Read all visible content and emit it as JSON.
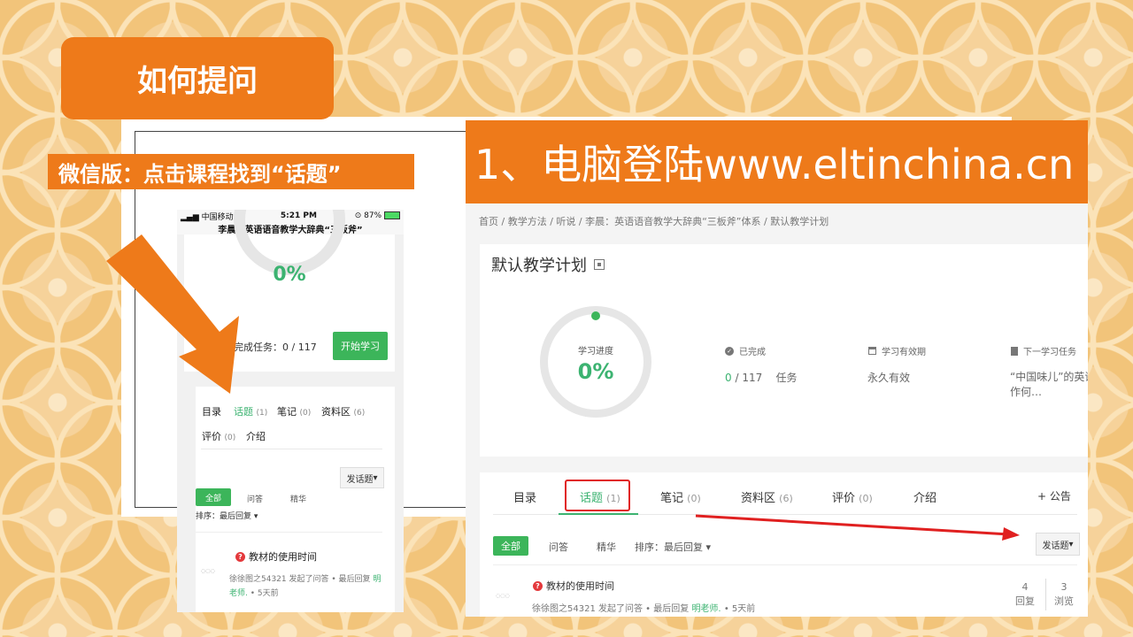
{
  "slide": {
    "title": "如何提问",
    "wechat_label": "微信版：点击课程找到“话题”",
    "desktop_heading": "1、电脑登陆www.eltinchina.cn"
  },
  "phone": {
    "status": {
      "carrier": "中国移动",
      "time": "5:21 PM",
      "battery": "87%"
    },
    "title": "李晨：英语语音教学大辞典“三板斧”",
    "progress_pct": "0%",
    "tasks": "完成任务：0 / 117",
    "start_button": "开始学习",
    "tabs": [
      {
        "label": "目录",
        "count": ""
      },
      {
        "label": "话题",
        "count": "(1)"
      },
      {
        "label": "笔记",
        "count": "(0)"
      },
      {
        "label": "资料区",
        "count": "(6)"
      },
      {
        "label": "评价",
        "count": "(0)"
      },
      {
        "label": "介绍",
        "count": ""
      }
    ],
    "post_button": "发话题",
    "filters": [
      "全部",
      "问答",
      "精华"
    ],
    "sort": "排序：最后回复",
    "topic": {
      "title": "教材的使用时间",
      "meta": "徐徐图之54321 发起了问答 • 最后回复",
      "replier": "明老师.",
      "time": "• 5天前"
    }
  },
  "desktop": {
    "breadcrumb": "首页 / 教学方法 / 听说 / 李晨：英语语音教学大辞典“三板斧”体系 / 默认教学计划",
    "plan_title": "默认教学计划",
    "progress_label": "学习进度",
    "progress_pct": "0%",
    "progress_value": 0,
    "stats": {
      "completed_label": "已完成",
      "completed_value": "0",
      "completed_total": "/ 117",
      "completed_unit": "任务",
      "validity_label": "学习有效期",
      "validity_value": "永久有效",
      "next_label": "下一学习任务",
      "next_value_line1": "“中国味儿”的英语",
      "next_value_line2": "作何…"
    },
    "tabs": [
      {
        "label": "目录",
        "count": ""
      },
      {
        "label": "话题",
        "count": "(1)"
      },
      {
        "label": "笔记",
        "count": "(0)"
      },
      {
        "label": "资料区",
        "count": "(6)"
      },
      {
        "label": "评价",
        "count": "(0)"
      },
      {
        "label": "介绍",
        "count": ""
      }
    ],
    "announce": "+ 公告",
    "filters": [
      "全部",
      "问答",
      "精华"
    ],
    "sort": "排序：最后回复",
    "post_button": "发话题",
    "topic": {
      "title": "教材的使用时间",
      "author_meta": "徐徐图之54321  发起了问答  •  最后回复",
      "replier": "明老师.",
      "time": "•  5天前",
      "replies": "4",
      "replies_label": "回复",
      "views": "3",
      "views_label": "浏览"
    }
  },
  "colors": {
    "accent": "#ee7a1a",
    "green": "#3cb55a",
    "highlight_red": "#e02020"
  }
}
